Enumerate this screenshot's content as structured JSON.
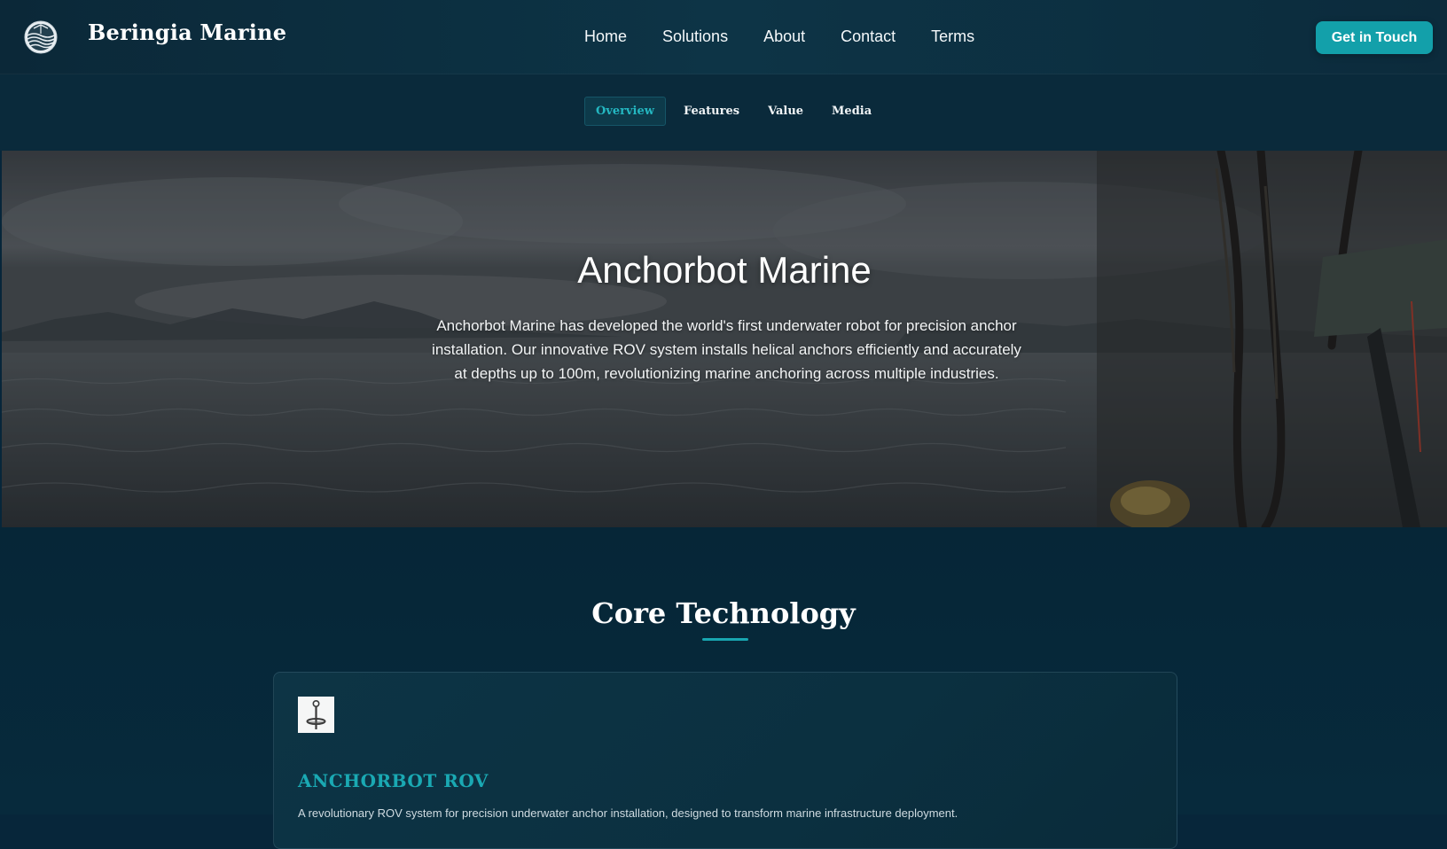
{
  "header": {
    "brand": "Beringia Marine",
    "logo_icon": "globe-waves-icon",
    "nav": [
      "Home",
      "Solutions",
      "About",
      "Contact",
      "Terms"
    ],
    "cta_label": "Get in Touch"
  },
  "subnav": {
    "tabs": [
      "Overview",
      "Features",
      "Value",
      "Media"
    ],
    "active": "Overview"
  },
  "hero": {
    "title": "Anchorbot Marine",
    "description": "Anchorbot Marine has developed the world's first underwater robot for precision anchor installation. Our innovative ROV system installs helical anchors efficiently and accurately at depths up to 100m, revolutionizing marine anchoring across multiple industries."
  },
  "core": {
    "title": "Core Technology",
    "card": {
      "icon": "helical-anchor-icon",
      "title": "ANCHORBOT ROV",
      "text": "A revolutionary ROV system for precision underwater anchor installation, designed to transform marine infrastructure deployment."
    }
  },
  "colors": {
    "accent": "#13a0aa",
    "accent_text": "#1aa9b3",
    "background": "#07263a"
  }
}
